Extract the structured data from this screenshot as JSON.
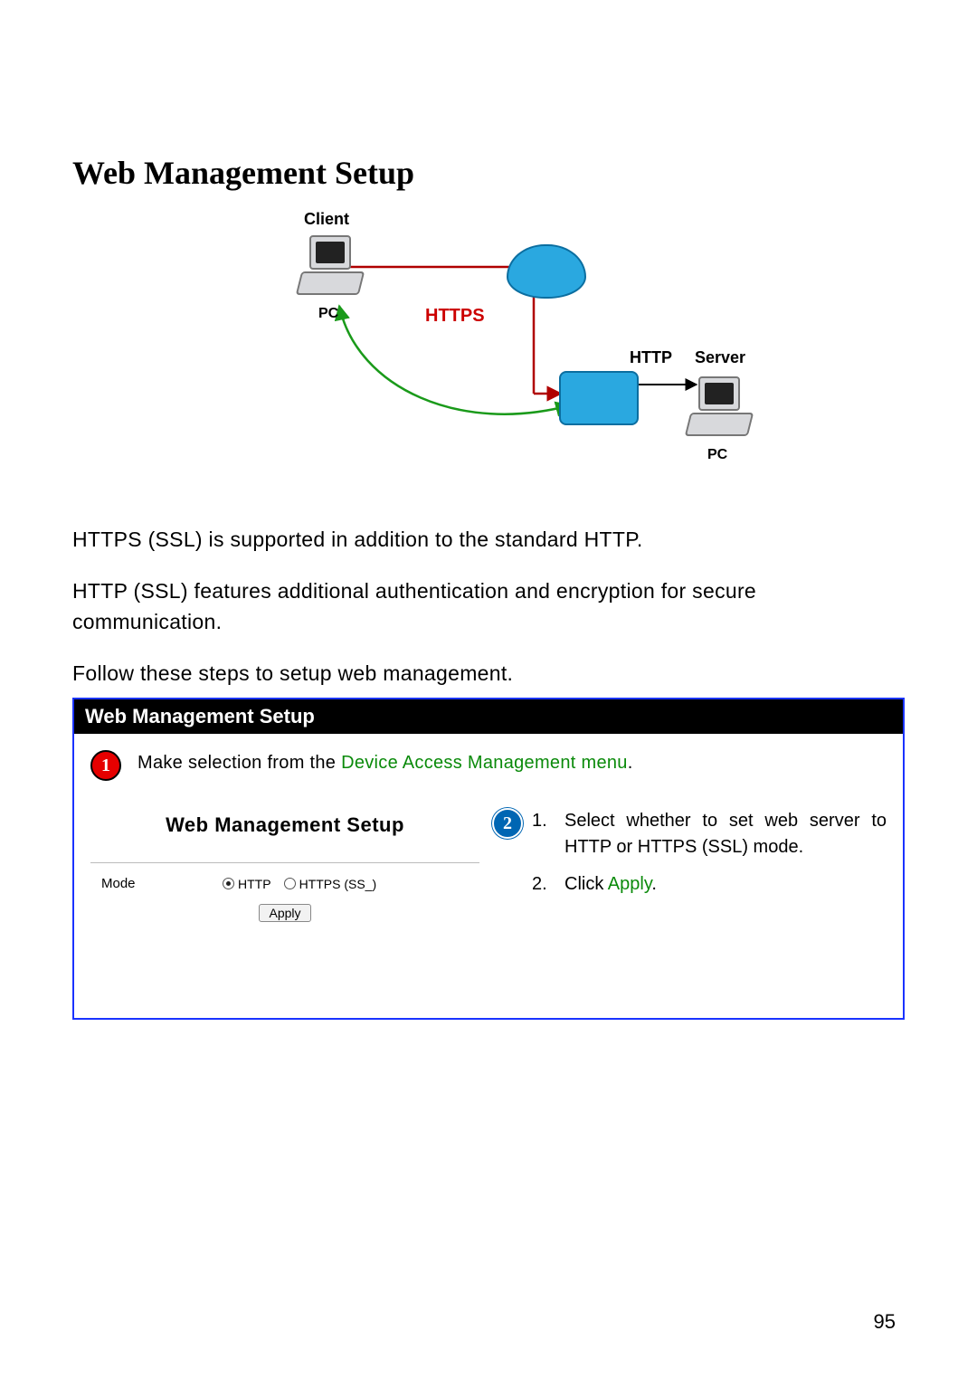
{
  "title": "Web Management Setup",
  "diagram": {
    "client_label": "Client",
    "client_pc_label": "PC",
    "https_label": "HTTPS",
    "http_label": "HTTP",
    "server_label": "Server",
    "server_pc_label": "PC"
  },
  "para1": "HTTPS (SSL) is supported in addition to the standard HTTP.",
  "para2": "HTTP (SSL) features additional authentication and encryption for secure communication.",
  "para3": "Follow these steps to setup web management.",
  "box": {
    "header": "Web Management Setup",
    "step1": {
      "number": "1",
      "text_before": "Make selection from the ",
      "text_green": "Device Access Management menu",
      "text_after": "."
    },
    "ui": {
      "title": "Web Management Setup",
      "mode_label": "Mode",
      "radio_http": "HTTP",
      "radio_https": "HTTPS (SS_)",
      "apply": "Apply"
    },
    "step2": {
      "number": "2",
      "items": [
        {
          "num": "1.",
          "text": "Select whether to set web server to HTTP or HTTPS (SSL) mode."
        },
        {
          "num": "2.",
          "text_before": "Click ",
          "text_green": "Apply",
          "text_after": "."
        }
      ]
    }
  },
  "page_number": "95"
}
